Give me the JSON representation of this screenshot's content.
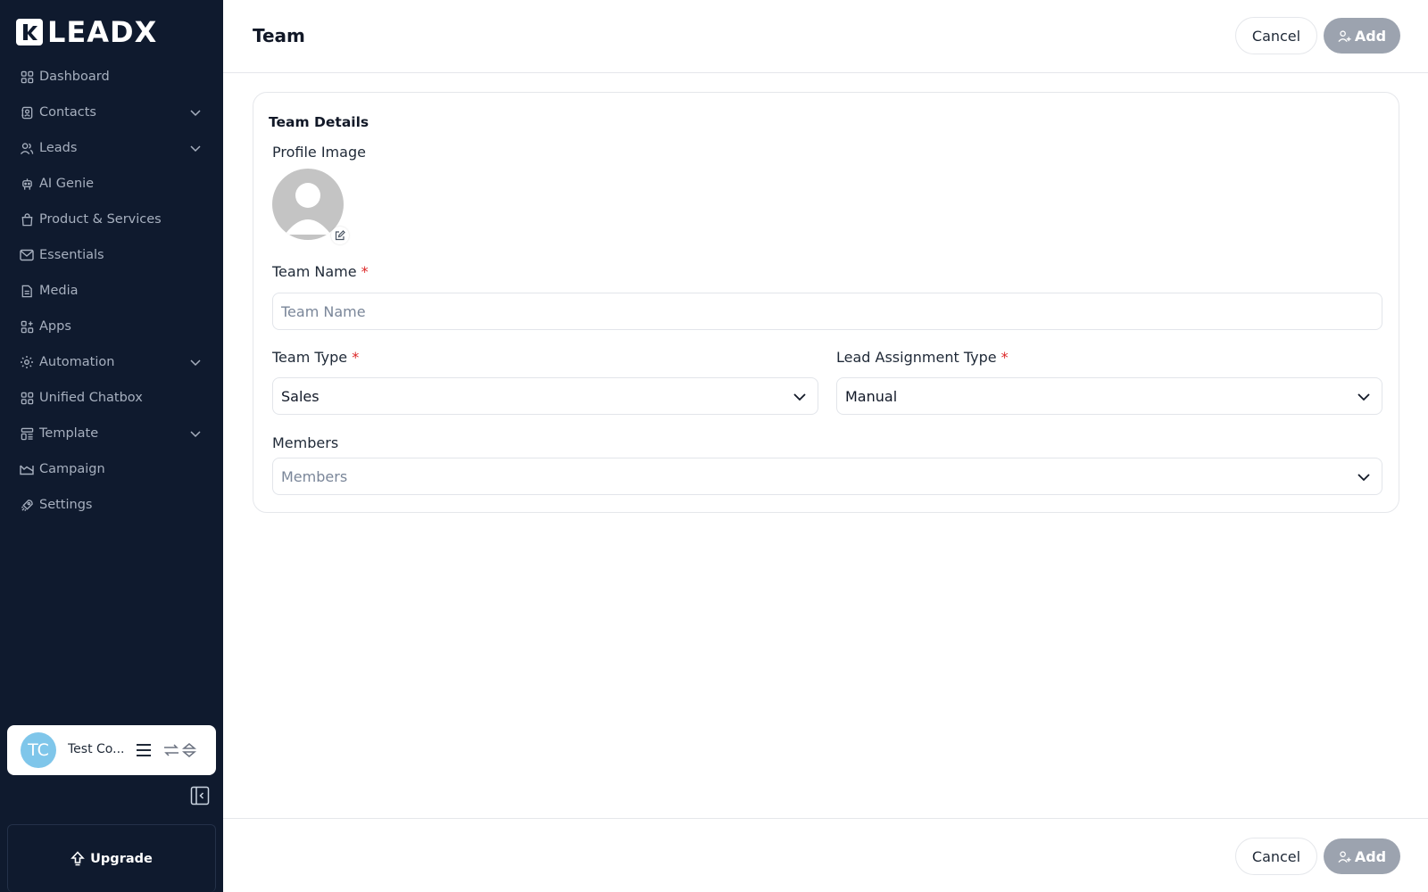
{
  "app": {
    "logo_text": "LEADX"
  },
  "sidebar": {
    "items": [
      {
        "label": "Dashboard",
        "icon": "grid-icon",
        "has_children": false
      },
      {
        "label": "Contacts",
        "icon": "contact-book-icon",
        "has_children": true
      },
      {
        "label": "Leads",
        "icon": "users-icon",
        "has_children": true
      },
      {
        "label": "AI Genie",
        "icon": "robot-icon",
        "has_children": false
      },
      {
        "label": "Product & Services",
        "icon": "shopping-bag-icon",
        "has_children": false
      },
      {
        "label": "Essentials",
        "icon": "mail-icon",
        "has_children": false
      },
      {
        "label": "Media",
        "icon": "document-icon",
        "has_children": false
      },
      {
        "label": "Apps",
        "icon": "apps-plus-icon",
        "has_children": false
      },
      {
        "label": "Automation",
        "icon": "gear-automation-icon",
        "has_children": true
      },
      {
        "label": "Unified Chatbox",
        "icon": "grid-icon",
        "has_children": false
      },
      {
        "label": "Template",
        "icon": "template-icon",
        "has_children": true
      },
      {
        "label": "Campaign",
        "icon": "envelope-open-icon",
        "has_children": false
      },
      {
        "label": "Settings",
        "icon": "rocket-icon",
        "has_children": false
      }
    ],
    "profile": {
      "initials": "TC",
      "name": "Test Co..."
    },
    "upgrade_label": "Upgrade"
  },
  "header": {
    "title": "Team",
    "cancel_label": "Cancel",
    "add_label": "Add"
  },
  "form": {
    "section_title": "Team Details",
    "profile_image_label": "Profile Image",
    "team_name": {
      "label": "Team Name",
      "required_mark": "*",
      "placeholder": "Team Name",
      "value": ""
    },
    "team_type": {
      "label": "Team Type",
      "required_mark": "*",
      "value": "Sales"
    },
    "lead_assignment_type": {
      "label": "Lead Assignment Type",
      "required_mark": "*",
      "value": "Manual"
    },
    "members": {
      "label": "Members",
      "placeholder": "Members"
    }
  },
  "footer": {
    "cancel_label": "Cancel",
    "add_label": "Add"
  },
  "colors": {
    "sidebar_bg": "#0f1a2e",
    "nav_text": "#a7b0bf",
    "add_button_disabled": "#9ca3af",
    "avatar_bg": "#7fc6ea",
    "required": "#dc2626"
  }
}
